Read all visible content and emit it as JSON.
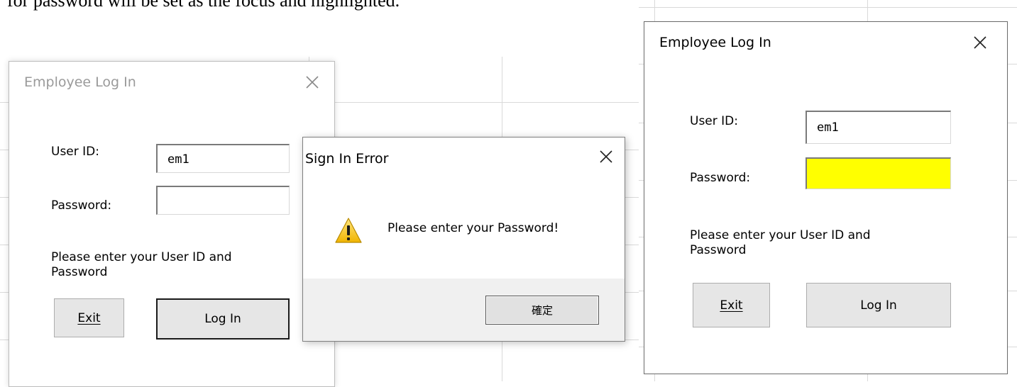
{
  "doc": {
    "caption": "for password will be set as the focus and highlighted."
  },
  "dialog_left": {
    "title": "Employee Log In",
    "user_id_label": "User ID:",
    "user_id_value": "em1",
    "password_label": "Password:",
    "password_value": "",
    "message": "Please enter your User ID and Password",
    "exit_label": "Exit",
    "login_label": "Log In"
  },
  "error_dialog": {
    "title": "Sign In Error",
    "message": "Please enter your Password!",
    "ok_label": "確定"
  },
  "dialog_right": {
    "title": "Employee Log In",
    "user_id_label": "User ID:",
    "user_id_value": "em1",
    "password_label": "Password:",
    "password_value": "",
    "message": "Please enter your User ID and Password",
    "exit_label": "Exit",
    "login_label": "Log In",
    "password_highlight_color": "#ffff00"
  },
  "icons": [
    "close-icon",
    "warning-icon"
  ]
}
